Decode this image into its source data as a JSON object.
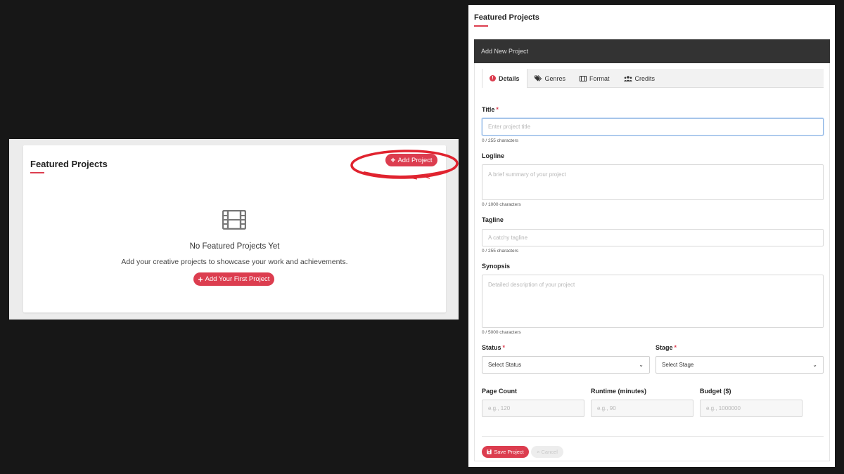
{
  "left_panel": {
    "title": "Featured Projects",
    "add_button_label": "Add Project",
    "add_button_icon": "plus-icon",
    "empty_icon": "film-icon",
    "empty_title": "No Featured Projects Yet",
    "empty_subtitle": "Add your creative projects to showcase your work and achievements.",
    "add_first_button_label": "Add Your First Project",
    "accent_color": "#dc3d4f",
    "highlight_mark_color": "#e0232f"
  },
  "right_panel": {
    "title": "Featured Projects",
    "modal_title": "Add New Project",
    "tabs": [
      {
        "label": "Details",
        "icon": "alert-circle-icon",
        "active": true
      },
      {
        "label": "Genres",
        "icon": "tags-icon",
        "active": false
      },
      {
        "label": "Format",
        "icon": "film-icon",
        "active": false
      },
      {
        "label": "Credits",
        "icon": "users-icon",
        "active": false
      }
    ],
    "form": {
      "title_label": "Title",
      "title_placeholder": "Enter project title",
      "title_counter": "0 / 255 characters",
      "logline_label": "Logline",
      "logline_placeholder": "A brief summary of your project",
      "logline_counter": "0 / 1000 characters",
      "tagline_label": "Tagline",
      "tagline_placeholder": "A catchy tagline",
      "tagline_counter": "0 / 255 characters",
      "synopsis_label": "Synopsis",
      "synopsis_placeholder": "Detailed description of your project",
      "synopsis_counter": "0 / 5000 characters",
      "status_label": "Status",
      "status_value": "Select Status",
      "stage_label": "Stage",
      "stage_value": "Select Stage",
      "page_count_label": "Page Count",
      "page_count_placeholder": "e.g., 120",
      "runtime_label": "Runtime (minutes)",
      "runtime_placeholder": "e.g., 90",
      "budget_label": "Budget ($)",
      "budget_placeholder": "e.g., 1000000",
      "required_mark": "*"
    },
    "save_button_label": "Save Project",
    "save_button_icon": "floppy-icon",
    "cancel_button_label": "Cancel",
    "cancel_button_icon": "close-icon"
  }
}
